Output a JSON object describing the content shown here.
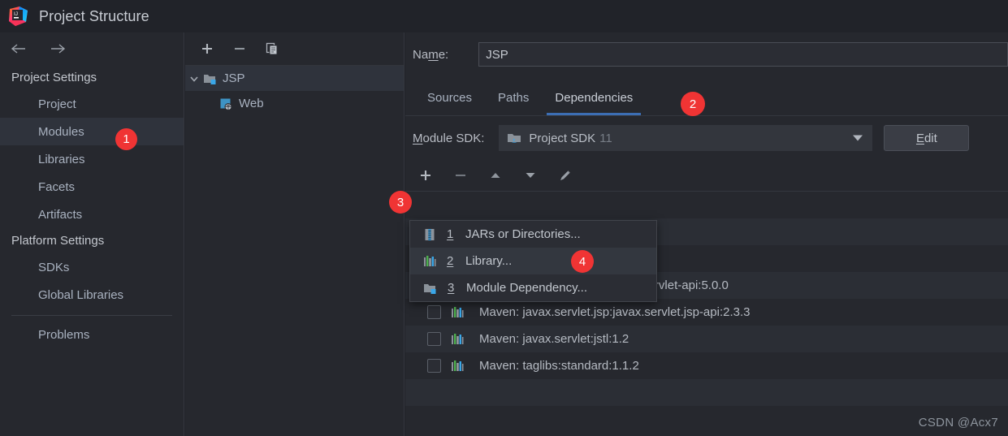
{
  "window": {
    "title": "Project Structure",
    "logo_icon": "intellij-idea-logo"
  },
  "sidebar": {
    "back_icon": "arrow-left-icon",
    "forward_icon": "arrow-right-icon",
    "groups": [
      {
        "label": "Project Settings"
      },
      {
        "label": "Platform Settings"
      }
    ],
    "items": [
      {
        "label": "Project",
        "selected": false
      },
      {
        "label": "Modules",
        "selected": true
      },
      {
        "label": "Libraries",
        "selected": false
      },
      {
        "label": "Facets",
        "selected": false
      },
      {
        "label": "Artifacts",
        "selected": false
      },
      {
        "label": "SDKs",
        "selected": false
      },
      {
        "label": "Global Libraries",
        "selected": false
      },
      {
        "label": "Problems",
        "selected": false
      }
    ]
  },
  "tree_panel": {
    "toolbar": [
      {
        "name": "add-module-button",
        "icon": "plus-icon"
      },
      {
        "name": "remove-module-button",
        "icon": "minus-icon"
      },
      {
        "name": "copy-module-button",
        "icon": "copy-icon"
      }
    ],
    "nodes": [
      {
        "label": "JSP",
        "icon": "module-folder-icon",
        "expanded": true,
        "selected": true
      },
      {
        "label": "Web",
        "icon": "web-facet-icon",
        "expanded": false,
        "selected": false
      }
    ],
    "expand_icon": "chevron-down-icon"
  },
  "main": {
    "name_label": "Name:",
    "name_label_mnemonic": "m",
    "name_value": "JSP",
    "tabs": [
      {
        "label": "Sources",
        "active": false
      },
      {
        "label": "Paths",
        "active": false
      },
      {
        "label": "Dependencies",
        "active": true
      }
    ],
    "sdk_label": "Module SDK:",
    "sdk_label_mnemonic": "M",
    "sdk_value": "Project SDK",
    "sdk_version": "11",
    "sdk_icon": "jdk-folder-icon",
    "edit_button": "Edit",
    "edit_button_mnemonic": "E",
    "dep_toolbar": [
      {
        "name": "add-dependency-button",
        "icon": "plus-icon"
      },
      {
        "name": "remove-dependency-button",
        "icon": "minus-icon"
      },
      {
        "name": "move-up-button",
        "icon": "triangle-up-icon"
      },
      {
        "name": "move-down-button",
        "icon": "triangle-down-icon"
      },
      {
        "name": "edit-dependency-button",
        "icon": "pencil-icon"
      }
    ],
    "dependencies": [
      {
        "label": "Maven: jakarta.servlet:jakarta.servlet-api:5.0.0",
        "icon": "library-icon",
        "checked": false
      },
      {
        "label": "Maven: javax.servlet.jsp:javax.servlet.jsp-api:2.3.3",
        "icon": "library-icon",
        "checked": false
      },
      {
        "label": "Maven: javax.servlet:jstl:1.2",
        "icon": "library-icon",
        "checked": false
      },
      {
        "label": "Maven: taglibs:standard:1.1.2",
        "icon": "library-icon",
        "checked": false
      }
    ]
  },
  "popup_menu": {
    "items": [
      {
        "num": "1",
        "label": "JARs or Directories...",
        "icon": "jar-icon",
        "highlighted": false
      },
      {
        "num": "2",
        "label": "Library...",
        "icon": "library-icon",
        "highlighted": true
      },
      {
        "num": "3",
        "label": "Module Dependency...",
        "icon": "module-folder-icon",
        "highlighted": false
      }
    ]
  },
  "badges": [
    {
      "label": "1",
      "target": "sidebar-item-modules"
    },
    {
      "label": "2",
      "target": "tab-dependencies"
    },
    {
      "label": "3",
      "target": "add-dependency-button"
    },
    {
      "label": "4",
      "target": "menu-item-library"
    }
  ],
  "watermark": "CSDN @Acx7",
  "colors": {
    "accent": "#3c6eb4",
    "badge": "#f03434",
    "background": "#26282e",
    "selection": "#2f333c"
  }
}
